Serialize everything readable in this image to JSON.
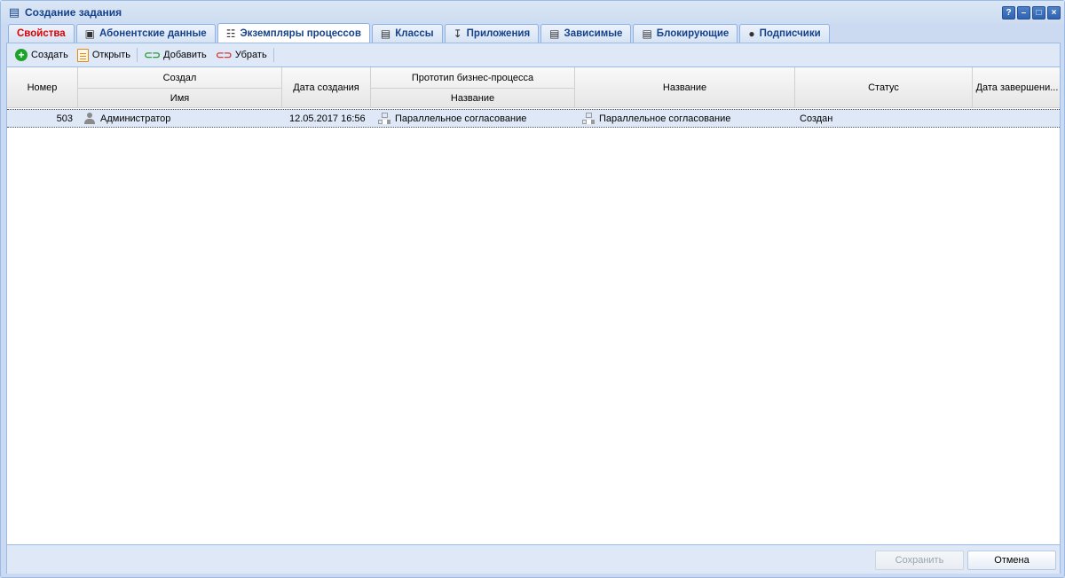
{
  "window": {
    "title": "Создание задания",
    "tools": [
      "?",
      "–",
      "□",
      "×"
    ]
  },
  "tabs": [
    {
      "label": "Свойства",
      "icon": "none"
    },
    {
      "label": "Абонентские данные",
      "icon": "contact-card-icon"
    },
    {
      "label": "Экземпляры процессов",
      "icon": "process-tree-icon",
      "active": true
    },
    {
      "label": "Классы",
      "icon": "document-icon"
    },
    {
      "label": "Приложения",
      "icon": "attachment-icon"
    },
    {
      "label": "Зависимые",
      "icon": "document-icon"
    },
    {
      "label": "Блокирующие",
      "icon": "document-icon"
    },
    {
      "label": "Подписчики",
      "icon": "user-icon"
    }
  ],
  "toolbar": {
    "create": "Создать",
    "open": "Открыть",
    "add": "Добавить",
    "remove": "Убрать"
  },
  "grid": {
    "headers": {
      "number": "Номер",
      "created_by": "Создал",
      "created_by_name": "Имя",
      "created_date": "Дата создания",
      "prototype": "Прототип бизнес-процесса",
      "prototype_name": "Название",
      "name": "Название",
      "status": "Статус",
      "end_date": "Дата завершени..."
    },
    "rows": [
      {
        "number": "503",
        "author": "Администратор",
        "created": "12.05.2017 16:56",
        "prototype": "Параллельное согласование",
        "name": "Параллельное согласование",
        "status": "Создан",
        "end": ""
      }
    ]
  },
  "footer": {
    "save": "Сохранить",
    "cancel": "Отмена"
  },
  "colors": {
    "accent_red_tab": "#e00000",
    "title_text": "#15428b",
    "selected_row": "#dfe8f6"
  }
}
